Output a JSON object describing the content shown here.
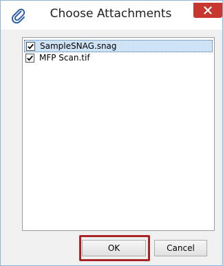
{
  "dialog": {
    "title": "Choose Attachments",
    "title_icon": "paperclip-icon",
    "close_icon": "close-icon",
    "close_color": "#c7372f"
  },
  "attachments": [
    {
      "label": "SampleSNAG.snag",
      "checked": true,
      "selected": true
    },
    {
      "label": "MFP Scan.tif",
      "checked": true,
      "selected": false
    }
  ],
  "buttons": {
    "ok_label": "OK",
    "cancel_label": "Cancel"
  },
  "highlight_color": "#a62424"
}
